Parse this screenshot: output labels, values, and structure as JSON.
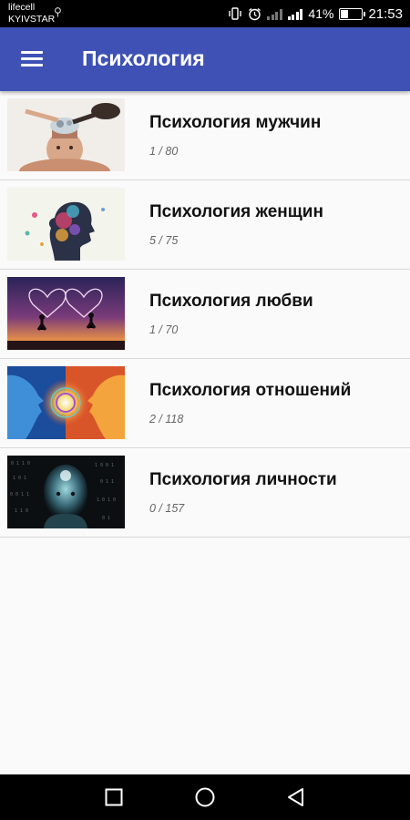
{
  "status_bar": {
    "carrier_1": "lifecell",
    "carrier_2": "KYIVSTAR",
    "battery": "41%",
    "battery_level": 0.41,
    "time": "21:53"
  },
  "toolbar": {
    "title": "Психология",
    "menu_icon": "hamburger-menu-icon",
    "background": "#3f51b5"
  },
  "categories": [
    {
      "title": "Психология мужчин",
      "progress": "1 / 80",
      "image": "man-brain-gears-image"
    },
    {
      "title": "Психология женщин",
      "progress": "5 / 75",
      "image": "woman-profile-colorful-image"
    },
    {
      "title": "Психология любви",
      "progress": "1 / 70",
      "image": "couple-hearts-sunset-image"
    },
    {
      "title": "Психология отношений",
      "progress": "2 / 118",
      "image": "faces-mandala-image"
    },
    {
      "title": "Психология личности",
      "progress": "0 / 157",
      "image": "digital-head-image"
    }
  ],
  "nav_bar": {
    "recents_icon": "square-recents-icon",
    "home_icon": "circle-home-icon",
    "back_icon": "triangle-back-icon"
  }
}
